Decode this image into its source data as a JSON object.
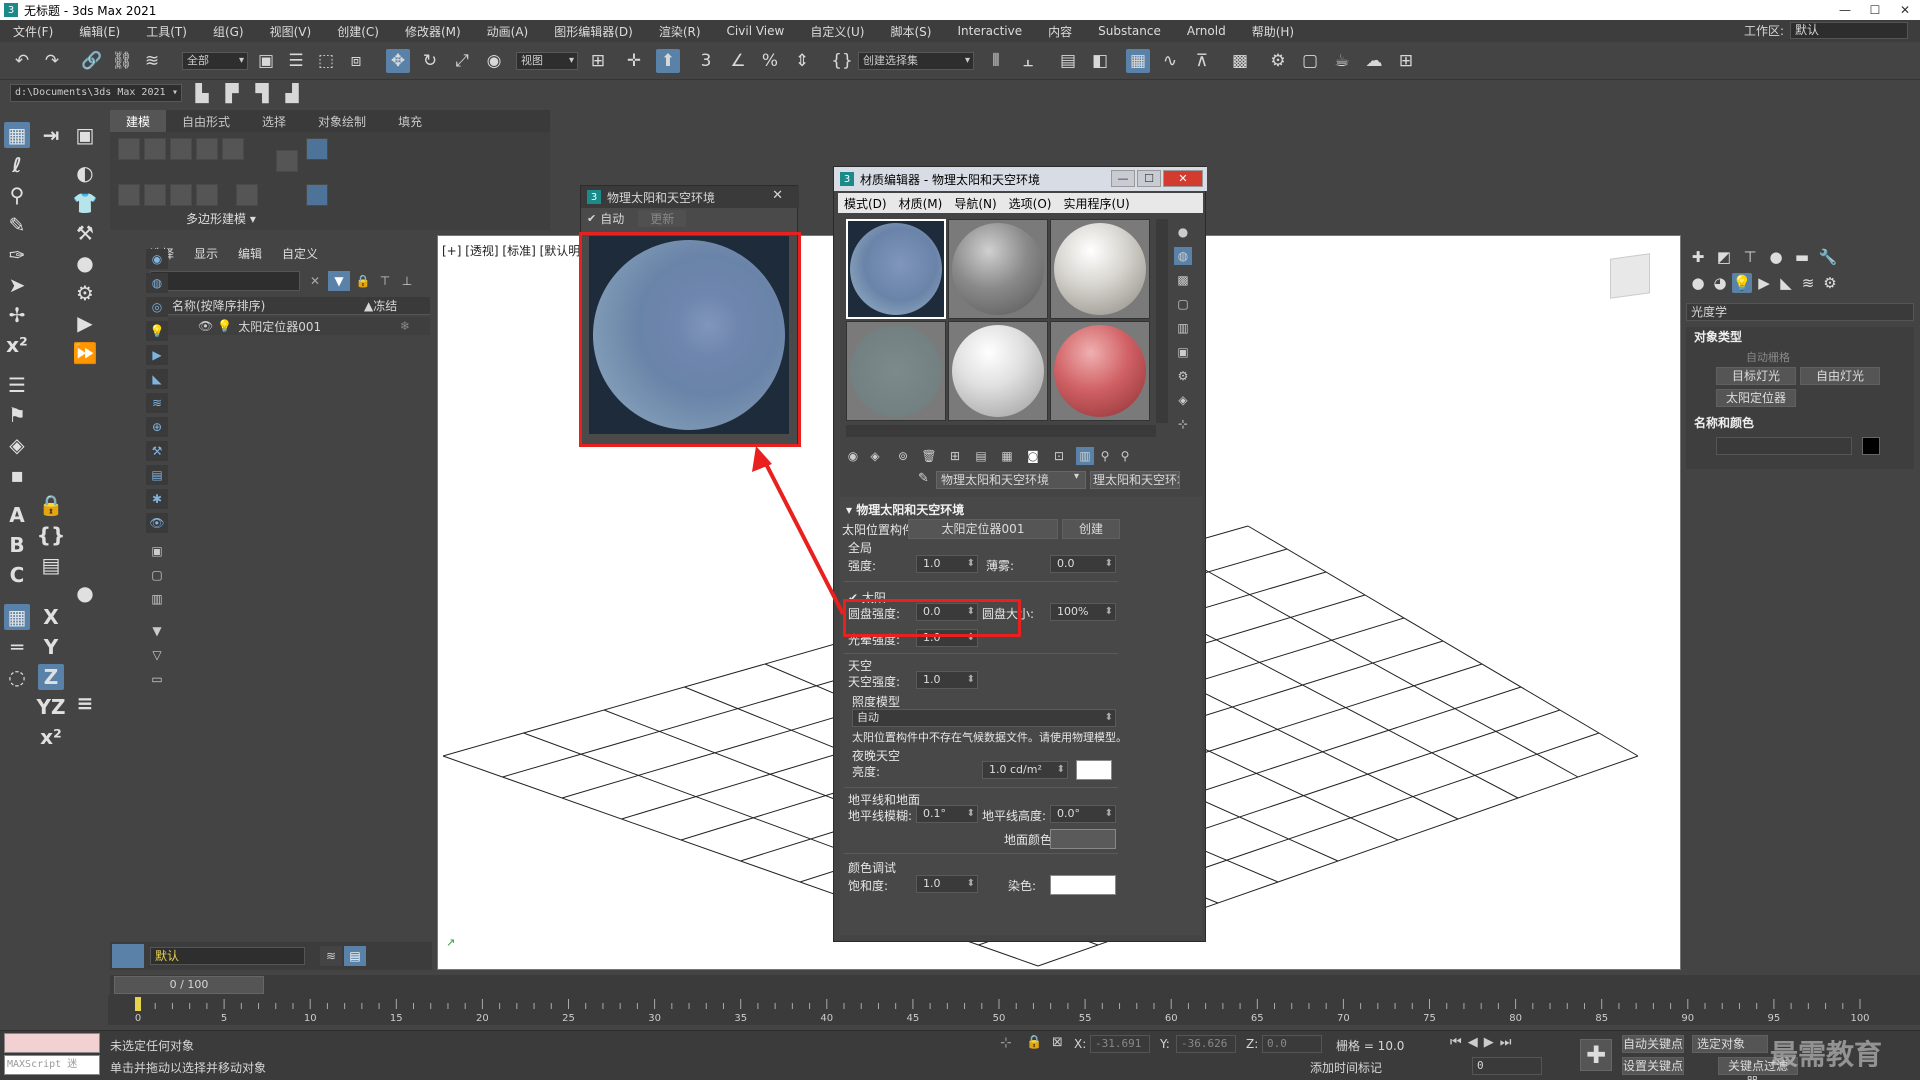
{
  "window": {
    "title": "无标题 - 3ds Max 2021",
    "app_icon": "3"
  },
  "menu": [
    "文件(F)",
    "编辑(E)",
    "工具(T)",
    "组(G)",
    "视图(V)",
    "创建(C)",
    "修改器(M)",
    "动画(A)",
    "图形编辑器(D)",
    "渲染(R)",
    "Civil View",
    "自定义(U)",
    "脚本(S)",
    "Interactive",
    "内容",
    "Substance",
    "Arnold",
    "帮助(H)"
  ],
  "workspace": {
    "label": "工作区:",
    "value": "默认"
  },
  "toolbar": {
    "selection_filter": "全部",
    "ref_coord": "视图",
    "named_selection": "创建选择集",
    "project_path": "d:\\Documents\\3ds Max 2021"
  },
  "ribbon": {
    "tabs": [
      "建模",
      "自由形式",
      "选择",
      "对象绘制",
      "填充"
    ],
    "group_label": "多边形建模 ▾"
  },
  "explorer": {
    "tabs": [
      "选择",
      "显示",
      "编辑",
      "自定义"
    ],
    "header_name": "名称(按降序排序)",
    "header_freeze": "▲冻结",
    "row_name": "太阳定位器001"
  },
  "layer": {
    "current": "默认"
  },
  "viewport": {
    "label": "[+] [透视] [标准] [默认明暗处理]"
  },
  "cmdpanel": {
    "category": "光度学",
    "object_type_title": "对象类型",
    "autogrid": "自动栅格",
    "buttons": [
      "目标灯光",
      "自由灯光",
      "太阳定位器"
    ],
    "name_color_title": "名称和颜色"
  },
  "preview": {
    "title": "物理太阳和天空环境",
    "auto": "自动",
    "update": "更新"
  },
  "mated": {
    "title": "材质编辑器 - 物理太阳和天空环境",
    "menu": [
      "模式(D)",
      "材质(M)",
      "导航(N)",
      "选项(O)",
      "实用程序(U)"
    ],
    "material_name": "物理太阳和天空环境",
    "material_type": "理太阳和天空环境",
    "rollout_title": "物理太阳和天空环境",
    "sun_position_label": "太阳位置构件:",
    "sun_position_value": "太阳定位器001",
    "create_btn": "创建",
    "global_label": "全局",
    "intensity_label": "强度:",
    "intensity_value": "1.0",
    "haze_label": "薄雾:",
    "haze_value": "0.0",
    "sun_label": "太阳",
    "disc_intensity_label": "圆盘强度:",
    "disc_intensity_value": "0.0",
    "disc_size_label": "圆盘大小:",
    "disc_size_value": "100%",
    "glow_label": "光晕强度:",
    "glow_value": "1.0",
    "sky_label": "天空",
    "sky_intensity_label": "天空强度:",
    "sky_intensity_value": "1.0",
    "illum_model_label": "照度模型",
    "illum_model_value": "自动",
    "illum_note": "太阳位置构件中不存在气候数据文件。请使用物理模型。",
    "night_sky_label": "夜晚天空",
    "luminance_label": "亮度:",
    "luminance_value": "1.0 cd/m²",
    "horizon_label": "地平线和地面",
    "horizon_blur_label": "地平线模糊:",
    "horizon_blur_value": "0.1°",
    "horizon_height_label": "地平线高度:",
    "horizon_height_value": "0.0°",
    "ground_color_label": "地面颜色:",
    "color_tweak_label": "颜色调试",
    "saturation_label": "饱和度:",
    "saturation_value": "1.0",
    "tint_label": "染色:"
  },
  "timeline": {
    "frame": "0 / 100",
    "ticks": [
      "0",
      "5",
      "10",
      "15",
      "20",
      "25",
      "30",
      "35",
      "40",
      "45",
      "50",
      "55",
      "60",
      "65",
      "70",
      "75",
      "80",
      "85",
      "90",
      "95",
      "100"
    ]
  },
  "status": {
    "script_label": "MAXScript 迷",
    "line1": "未选定任何对象",
    "line2": "单击并拖动以选择并移动对象",
    "x_label": "X:",
    "x_value": "-31.691",
    "y_label": "Y:",
    "y_value": "-36.626",
    "z_label": "Z:",
    "z_value": "0.0",
    "grid": "栅格 = 10.0",
    "add_time_tag": "添加时间标记",
    "auto_key": "自动关键点",
    "set_key": "设置关键点",
    "selected_obj": "选定对象",
    "key_filter": "关键点过滤器...",
    "frame_field": "0"
  },
  "watermark": "最需教育",
  "colors": {
    "accent": "#5a82a8",
    "annotation": "#e8201e",
    "viewport_bg": "#ffffff"
  }
}
